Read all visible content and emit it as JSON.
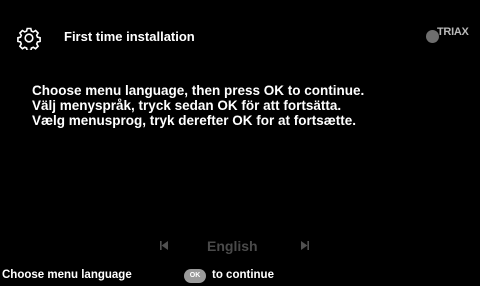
{
  "header": {
    "title": "First time installation",
    "settings_icon": "gear-icon",
    "brand": "TRIAX"
  },
  "messages": [
    "Choose menu language, then press OK to continue.",
    "Välj menyspråk, tryck sedan OK för att fortsätta.",
    "Vælg menusprog, tryk derefter OK for at fortsætte."
  ],
  "language_selector": {
    "value": "English",
    "prev_icon": "skip-previous-icon",
    "next_icon": "skip-next-icon"
  },
  "footer": {
    "hint": "Choose menu language",
    "ok_button_label": "OK",
    "continue_text": "to continue"
  },
  "colors": {
    "background": "#000000",
    "text": "#ffffff",
    "dimmed": "#4a4a4a"
  }
}
